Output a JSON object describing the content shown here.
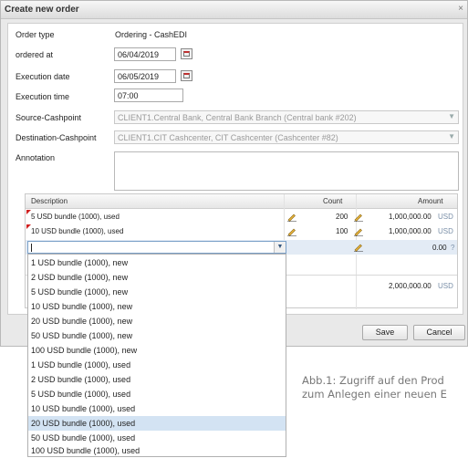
{
  "dialog": {
    "title": "Create new order",
    "close_glyph": "×",
    "close_icon": "close-icon"
  },
  "form": {
    "order_type_label": "Order type",
    "order_type_value": "Ordering - CashEDI",
    "ordered_at_label": "ordered at",
    "ordered_at_value": "06/04/2019",
    "execution_date_label": "Execution date",
    "execution_date_value": "06/05/2019",
    "execution_time_label": "Execution time",
    "execution_time_value": "07:00",
    "source_label": "Source-Cashpoint",
    "source_value": "CLIENT1.Central Bank, Central Bank Branch (Central bank #202)",
    "destination_label": "Destination-Cashpoint",
    "destination_value": "CLIENT1.CIT Cashcenter, CIT Cashcenter (Cashcenter #82)",
    "annotation_label": "Annotation",
    "calendar_icon": "calendar-icon",
    "dropdown_icon": "chevron-down-icon"
  },
  "grid": {
    "headers": [
      "Description",
      "Count",
      "Amount"
    ],
    "rows": [
      {
        "description": "5 USD bundle (1000), used",
        "count": "200",
        "amount": "1,000,000.00",
        "currency": "USD"
      },
      {
        "description": "10 USD bundle (1000), used",
        "count": "100",
        "amount": "1,000,000.00",
        "currency": "USD"
      }
    ],
    "edit_row": {
      "amount": "0.00",
      "currency": "?"
    },
    "total_amount": "2,000,000.00",
    "total_currency": "USD",
    "edit_icon": "pencil-icon"
  },
  "dropdown": {
    "options": [
      "1 USD bundle (1000), new",
      "2 USD bundle (1000), new",
      "5 USD bundle (1000), new",
      "10 USD bundle (1000), new",
      "20 USD bundle (1000), new",
      "50 USD bundle (1000), new",
      "100 USD bundle (1000), new",
      "1 USD bundle (1000), used",
      "2 USD bundle (1000), used",
      "5 USD bundle (1000), used",
      "10 USD bundle (1000), used",
      "20 USD bundle (1000), used",
      "50 USD bundle (1000), used",
      "100 USD bundle (1000), used"
    ],
    "highlighted": "20 USD bundle (1000), used"
  },
  "buttons": {
    "save": "Save",
    "cancel": "Cancel"
  },
  "caption": {
    "line1": "Abb.1: Zugriff auf den Prod",
    "line2": "zum Anlegen einer neuen E"
  }
}
